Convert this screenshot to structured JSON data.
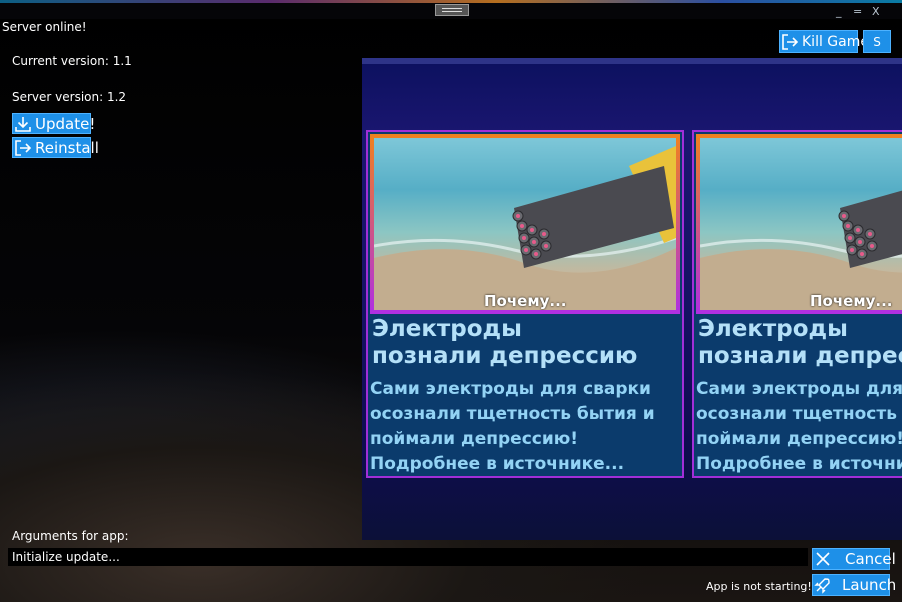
{
  "window": {
    "minimize_label": "_",
    "maximize_label": "=",
    "close_label": "X"
  },
  "status": {
    "server": "Server online!",
    "current_version": "Current version: 1.1",
    "server_version": "Server version: 1.2",
    "app_status": "App is not starting!"
  },
  "buttons": {
    "update": "Update!",
    "reinstall": "Reinstall",
    "kill_game": "Kill Game",
    "settings": "S",
    "cancel": "Cancel",
    "launch": "Launch"
  },
  "news": {
    "cards": [
      {
        "caption": "Почему...",
        "headline_line1": "Электроды",
        "headline_line2": "познали депрессию",
        "body_line1": "Сами электроды для сварки",
        "body_line2": "осознали тщетность бытия и",
        "body_line3": "поймали депрессию!",
        "body_line4": "Подробнее в источнике..."
      },
      {
        "caption": "Почему...",
        "headline_line1": "Электроды",
        "headline_line2": "познали депрессию",
        "body_line1": "Сами электроды для сварки",
        "body_line2": "осознали тщетность бытия и",
        "body_line3": "поймали депрессию!",
        "body_line4": "Подробнее в источнике..."
      }
    ]
  },
  "args": {
    "label": "Arguments for app:",
    "value": "Initialize update..."
  },
  "icons": {
    "update": "download-icon",
    "reinstall": "sign-out-icon",
    "kill_game": "sign-out-icon",
    "cancel": "close-icon",
    "launch": "rocket-icon"
  },
  "colors": {
    "accent": "#1e90e8",
    "card_border": "#a22fd8",
    "panel": "#151264"
  }
}
